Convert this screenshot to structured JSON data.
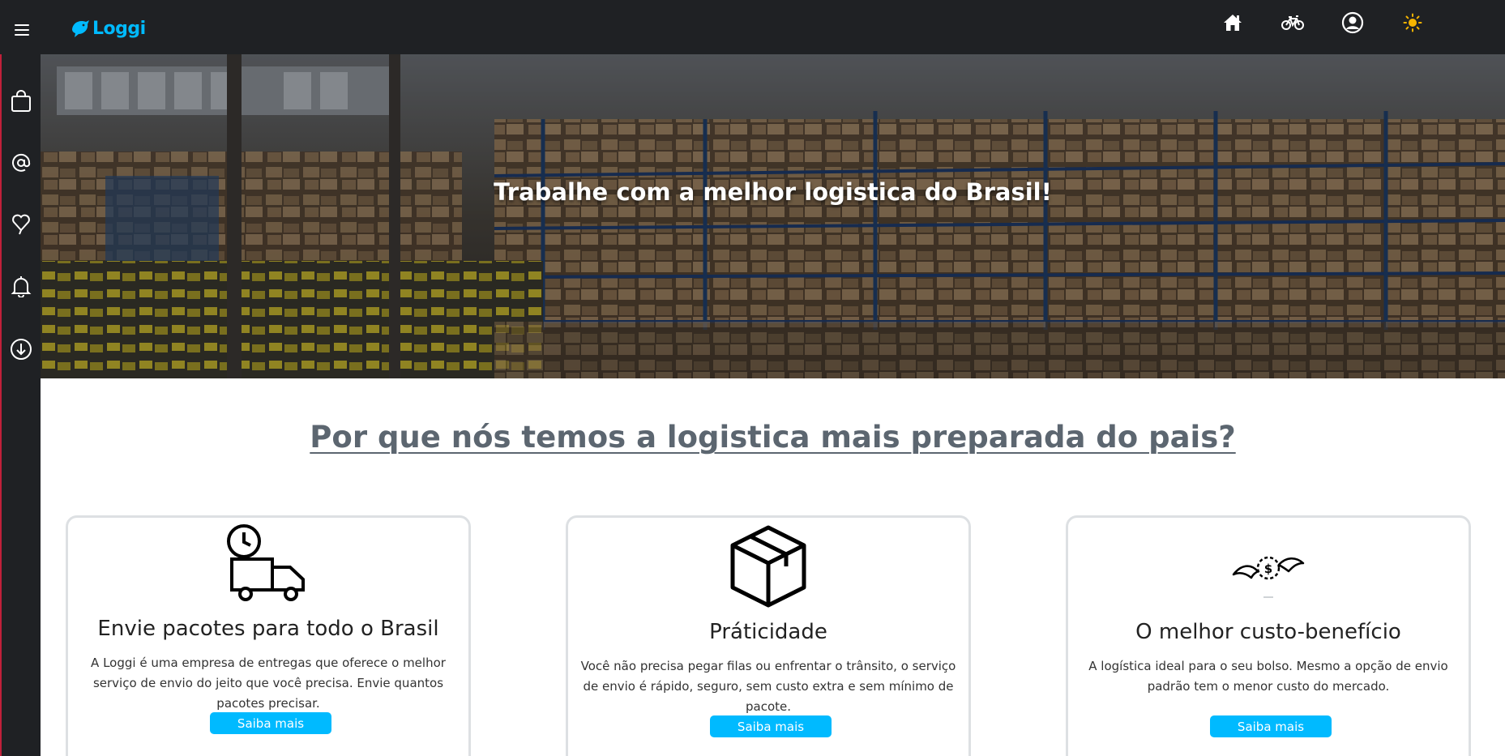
{
  "app": {
    "logo_text": "Loggi"
  },
  "topbar": {
    "icons": [
      "home-icon",
      "bicycle-icon",
      "user-circle-icon",
      "sun-icon"
    ]
  },
  "sidebar": {
    "icons": [
      "shopping-bag-icon",
      "at-icon",
      "heart-icon",
      "bell-icon",
      "download-icon"
    ]
  },
  "hero": {
    "title": "Trabalhe com a melhor logistica do Brasil!"
  },
  "section": {
    "title": "Por que nós temos a logistica mais preparada do pais?"
  },
  "cards": [
    {
      "icon": "delivery-truck-clock-icon",
      "title": "Envie pacotes para todo o Brasil",
      "text": "A Loggi é uma empresa de entregas que oferece o melhor serviço de envio do jeito que você precisa. Envie quantos pacotes precisar.",
      "button": "Saiba mais"
    },
    {
      "icon": "package-box-icon",
      "title": "Práticidade",
      "text": "Você não precisa pegar filas ou enfrentar o trânsito, o serviço de envio é rápido, seguro, sem custo extra e sem mínimo de pacote.",
      "button": "Saiba mais"
    },
    {
      "icon": "flying-money-icon",
      "title": "O melhor custo-benefício",
      "text": "A logística ideal para o seu bolso. Mesmo a opção de envio padrão tem o menor custo do mercado.",
      "button": "Saiba mais"
    }
  ],
  "colors": {
    "bar": "#1f2124",
    "accent": "#00baff",
    "sidebar_border": "#c0203a",
    "section_title": "#5c6670"
  }
}
